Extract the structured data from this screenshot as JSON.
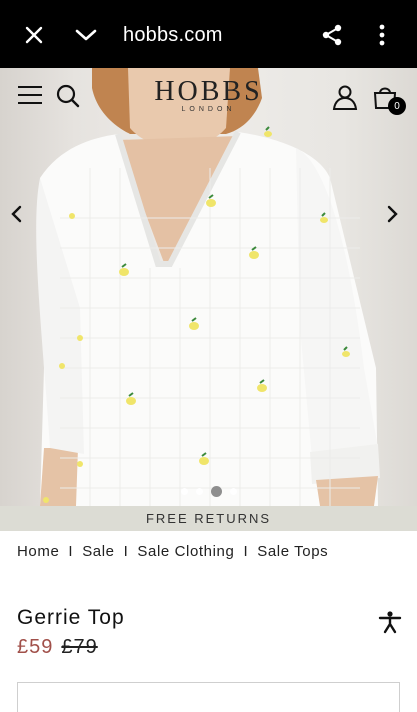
{
  "browser": {
    "url": "hobbs.com",
    "icons": [
      "close-icon",
      "chevron-down-icon",
      "share-icon",
      "more-vertical-icon"
    ]
  },
  "header": {
    "brand_name": "HOBBS",
    "brand_sub": "LONDON",
    "bag_count": "0",
    "icons": [
      "menu-icon",
      "search-icon",
      "account-icon",
      "bag-icon"
    ]
  },
  "gallery": {
    "image_count": 4,
    "active_index": 2
  },
  "banner": {
    "text": "FREE RETURNS"
  },
  "breadcrumb": {
    "items": [
      "Home",
      "Sale",
      "Sale Clothing",
      "Sale Tops"
    ],
    "separator": "I"
  },
  "product": {
    "title": "Gerrie Top",
    "price_now": "£59",
    "price_was": "£79",
    "price_now_color": "#a1504a"
  }
}
